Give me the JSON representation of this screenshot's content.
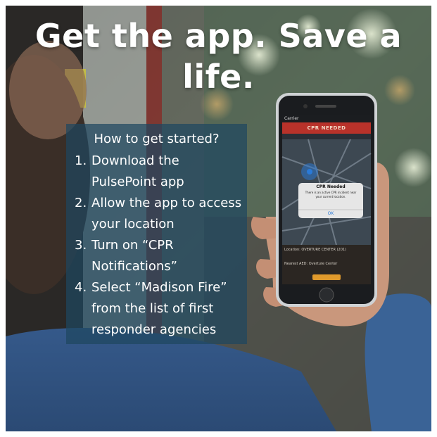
{
  "headline": {
    "line1": "Get the app. Save a",
    "line2": "life."
  },
  "guide": {
    "title": "How to get started?",
    "steps": [
      {
        "num": "1.",
        "line1": "Download the",
        "line2": "PulsePoint app"
      },
      {
        "num": "2.",
        "line1": "Allow the app to access",
        "line2": "your location"
      },
      {
        "num": "3.",
        "line1": "Turn on “CPR",
        "line2": "Notifications”"
      },
      {
        "num": "4.",
        "line1": "Select “Madison Fire”",
        "line2": "from the list of first",
        "line3": "responder agencies"
      }
    ]
  },
  "phone": {
    "status_carrier": "Carrier",
    "app_header": "CPR NEEDED",
    "alert_title": "CPR Needed",
    "alert_body1": "There is an active CPR incident near",
    "alert_body2": "your current location.",
    "alert_button": "OK",
    "location_label": "Location: OVERTURE CENTER (201)",
    "aed_label": "Nearest AED: Overture Center"
  },
  "colors": {
    "panel": "#1f465f",
    "headline": "#ffffff",
    "phone_red": "#b8322a",
    "alert_button": "#2a7ad8"
  }
}
